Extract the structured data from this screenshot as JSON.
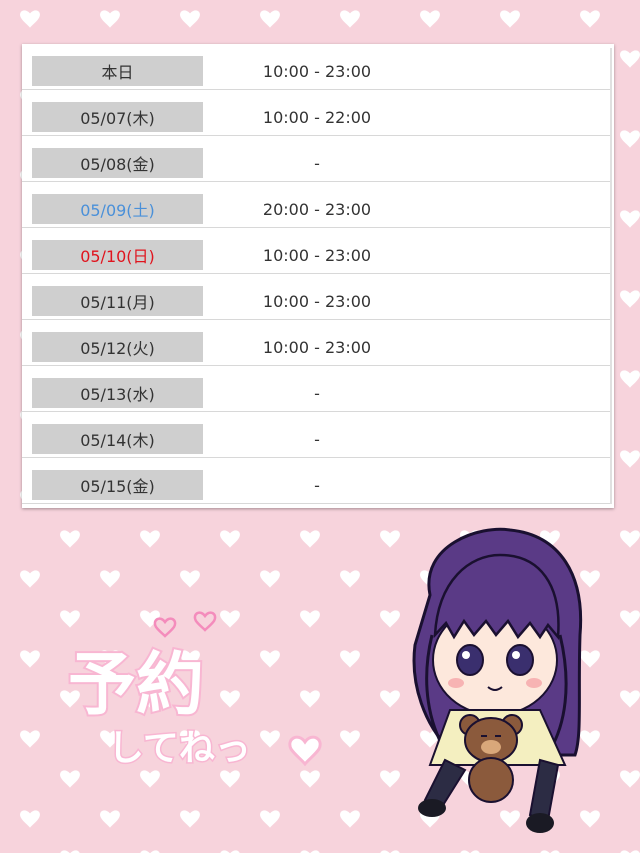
{
  "schedule": {
    "rows": [
      {
        "date": "本日",
        "time": "10:00 - 23:00",
        "day_type": "today"
      },
      {
        "date": "05/07(木)",
        "time": "10:00 - 22:00",
        "day_type": "weekday"
      },
      {
        "date": "05/08(金)",
        "time": "-",
        "day_type": "weekday"
      },
      {
        "date": "05/09(土)",
        "time": "20:00 - 23:00",
        "day_type": "saturday"
      },
      {
        "date": "05/10(日)",
        "time": "10:00 - 23:00",
        "day_type": "sunday"
      },
      {
        "date": "05/11(月)",
        "time": "10:00 - 23:00",
        "day_type": "weekday"
      },
      {
        "date": "05/12(火)",
        "time": "10:00 - 23:00",
        "day_type": "weekday"
      },
      {
        "date": "05/13(水)",
        "time": "-",
        "day_type": "weekday"
      },
      {
        "date": "05/14(木)",
        "time": "-",
        "day_type": "weekday"
      },
      {
        "date": "05/15(金)",
        "time": "-",
        "day_type": "weekday"
      }
    ]
  },
  "banner": {
    "title": "予約",
    "subtitle": "してねっ"
  },
  "colors": {
    "background": "#f7d3dc",
    "heart": "#ffffff",
    "saturday": "#4a90d9",
    "sunday": "#e0141e",
    "date_cell_bg": "#cfcfcf",
    "banner_text": "#f8b6d2"
  },
  "icons": [
    "heart-icon",
    "character-illustration"
  ]
}
